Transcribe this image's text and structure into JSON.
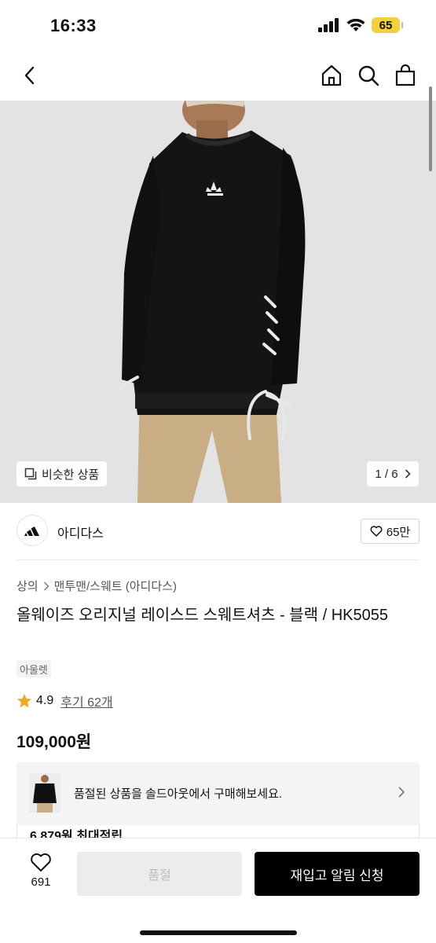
{
  "status_bar": {
    "time": "16:33",
    "battery": "65"
  },
  "nav": {
    "back": "back-icon",
    "home": "home-icon",
    "search": "search-icon",
    "bag": "shopping-bag-icon"
  },
  "hero": {
    "similar_label": "비슷한 상품",
    "page_indicator": "1 / 6"
  },
  "brand": {
    "name": "아디다스",
    "like_count": "65만"
  },
  "breadcrumb": {
    "category": "상의",
    "subcategory": "맨투맨/스웨트 (아디다스)"
  },
  "product": {
    "title": "올웨이즈 오리지널 레이스드 스웨트셔츠 - 블랙 / HK5055",
    "tag": "아울렛",
    "rating": "4.9",
    "reviews": "후기 62개",
    "price": "109,000원"
  },
  "soldout_banner": {
    "text": "품절된 상품을 솔드아웃에서 구매해보세요."
  },
  "points": {
    "text": "6,879원 최대적립"
  },
  "bottom": {
    "wish_count": "691",
    "soldout_label": "품절",
    "restock_label": "재입고 알림 신청"
  },
  "colors": {
    "star": "#f5a623",
    "primary_button": "#000000",
    "disabled_button": "#ececec"
  }
}
